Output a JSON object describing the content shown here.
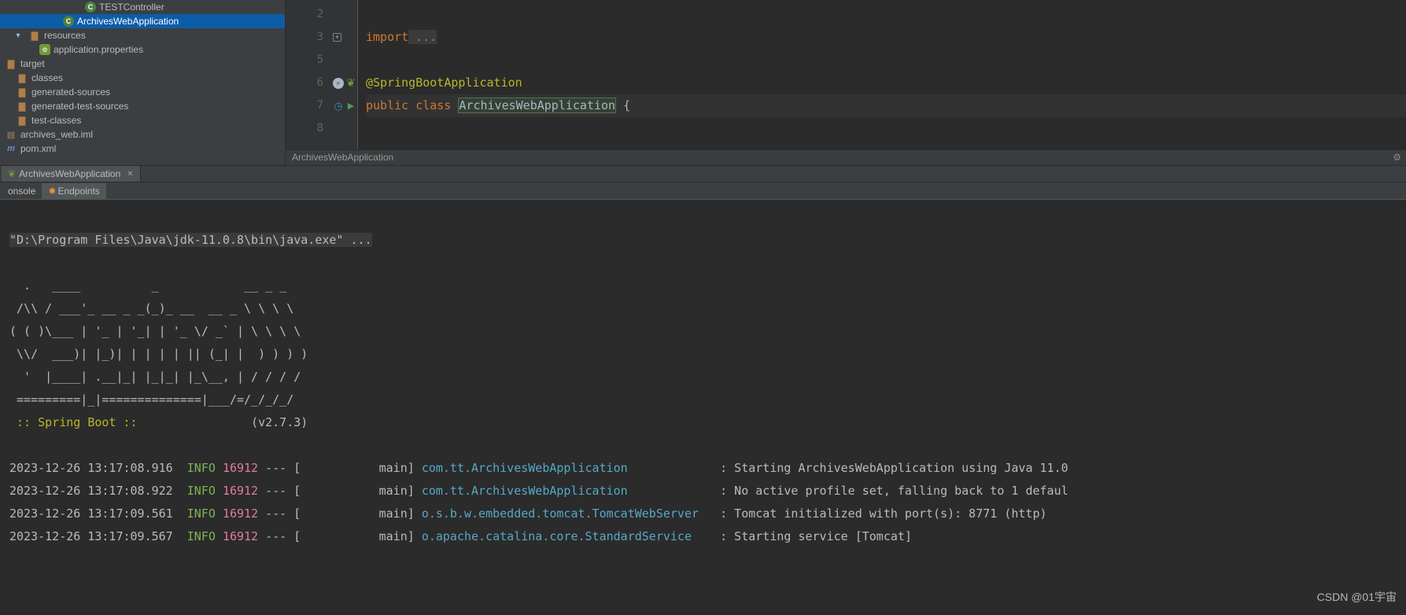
{
  "tree": {
    "items": [
      {
        "label": "TESTController",
        "depth": 102,
        "icon": "class",
        "sel": false,
        "exp": ""
      },
      {
        "label": "ArchivesWebApplication",
        "depth": 88,
        "icon": "class",
        "sel": true,
        "exp": ""
      },
      {
        "label": "resources",
        "depth": 44,
        "icon": "folder-src",
        "sel": false,
        "exp": "▾"
      },
      {
        "label": "application.properties",
        "depth": 60,
        "icon": "prop",
        "sel": false,
        "exp": ""
      },
      {
        "label": "target",
        "depth": 8,
        "icon": "folder",
        "sel": false,
        "exp": ""
      },
      {
        "label": "classes",
        "depth": 22,
        "icon": "folder",
        "sel": false,
        "exp": ""
      },
      {
        "label": "generated-sources",
        "depth": 22,
        "icon": "folder",
        "sel": false,
        "exp": ""
      },
      {
        "label": "generated-test-sources",
        "depth": 22,
        "icon": "folder",
        "sel": false,
        "exp": ""
      },
      {
        "label": "test-classes",
        "depth": 22,
        "icon": "folder",
        "sel": false,
        "exp": ""
      },
      {
        "label": "archives_web.iml",
        "depth": 8,
        "icon": "iml",
        "sel": false,
        "exp": ""
      },
      {
        "label": "pom.xml",
        "depth": 8,
        "icon": "maven",
        "sel": false,
        "exp": ""
      }
    ]
  },
  "editor": {
    "lines": [
      "2",
      "3",
      "5",
      "6",
      "7",
      "8"
    ],
    "import_kw": "import",
    "import_dots": " ...",
    "annotation": "@SpringBootApplication",
    "public_kw": "public ",
    "class_kw": "class ",
    "class_name": "ArchivesWebApplication",
    "brace": " {",
    "crumb": "ArchivesWebApplication"
  },
  "run": {
    "tab_label": "ArchivesWebApplication",
    "console_tab": "onsole",
    "endpoints_tab": "Endpoints"
  },
  "con": {
    "cmd": "\"D:\\Program Files\\Java\\jdk-11.0.8\\bin\\java.exe\" ...",
    "banner_1": "  .   ____          _            __ _ _",
    "banner_2": " /\\\\ / ___'_ __ _ _(_)_ __  __ _ \\ \\ \\ \\",
    "banner_3": "( ( )\\___ | '_ | '_| | '_ \\/ _` | \\ \\ \\ \\",
    "banner_4": " \\\\/  ___)| |_)| | | | | || (_| |  ) ) ) )",
    "banner_5": "  '  |____| .__|_| |_|_| |_\\__, | / / / /",
    "banner_6": " =========|_|==============|___/=/_/_/_/",
    "spring": " :: Spring Boot ::",
    "version": "(v2.7.3)",
    "log": [
      {
        "ts": "2023-12-26 13:17:08.916",
        "lvl": "INFO",
        "pid": "16912",
        "sep": " --- [           main] ",
        "lg": "com.tt.ArchivesWebApplication",
        "pad": "             ",
        "msg": ": Starting ArchivesWebApplication using Java 11.0"
      },
      {
        "ts": "2023-12-26 13:17:08.922",
        "lvl": "INFO",
        "pid": "16912",
        "sep": " --- [           main] ",
        "lg": "com.tt.ArchivesWebApplication",
        "pad": "             ",
        "msg": ": No active profile set, falling back to 1 defaul"
      },
      {
        "ts": "2023-12-26 13:17:09.561",
        "lvl": "INFO",
        "pid": "16912",
        "sep": " --- [           main] ",
        "lg": "o.s.b.w.embedded.tomcat.TomcatWebServer",
        "pad": "   ",
        "msg": ": Tomcat initialized with port(s): 8771 (http)"
      },
      {
        "ts": "2023-12-26 13:17:09.567",
        "lvl": "INFO",
        "pid": "16912",
        "sep": " --- [           main] ",
        "lg": "o.apache.catalina.core.StandardService",
        "pad": "    ",
        "msg": ": Starting service [Tomcat]"
      }
    ]
  },
  "watermark": "CSDN @01宇宙"
}
